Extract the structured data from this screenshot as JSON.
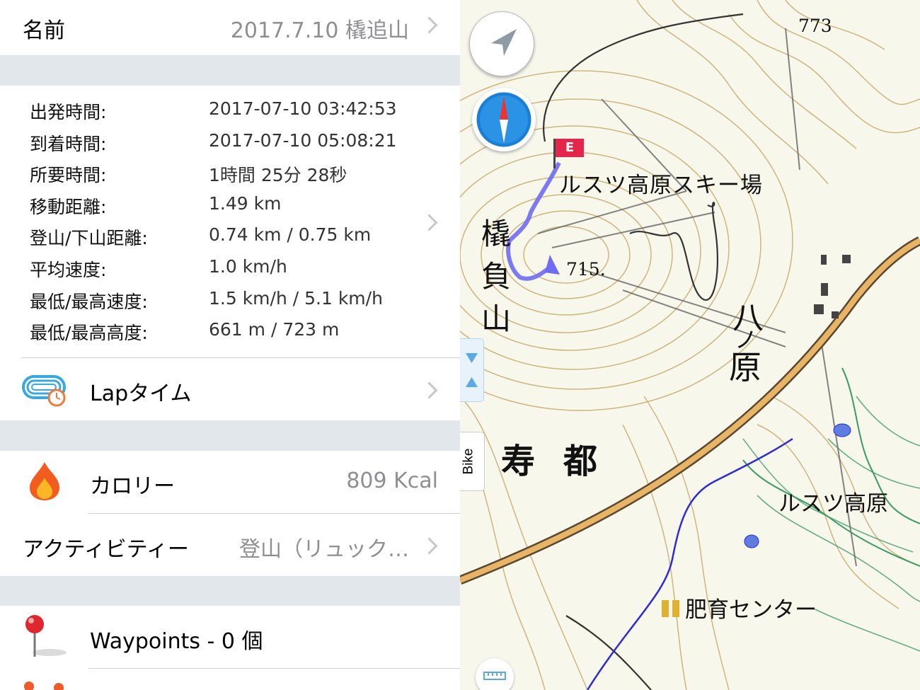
{
  "header": {
    "name_label": "名前",
    "name_value": "2017.7.10 橇追山"
  },
  "stats": [
    {
      "key": "出発時間:",
      "value": "2017-07-10 03:42:53"
    },
    {
      "key": "到着時間:",
      "value": "2017-07-10 05:08:21"
    },
    {
      "key": "所要時間:",
      "value": "1時間 25分 28秒"
    },
    {
      "key": "移動距離:",
      "value": "1.49 km"
    },
    {
      "key": "登山/下山距離:",
      "value": "0.74 km / 0.75 km"
    },
    {
      "key": "平均速度:",
      "value": "1.0 km/h"
    },
    {
      "key": "最低/最高速度:",
      "value": "1.5 km/h / 5.1 km/h"
    },
    {
      "key": "最低/最高高度:",
      "value": "661 m / 723 m"
    }
  ],
  "lap": {
    "label": "Lapタイム"
  },
  "calorie": {
    "label": "カロリー",
    "value": "809 Kcal"
  },
  "activity": {
    "label": "アクティビティー",
    "value": "登山（リュック…"
  },
  "waypoints": {
    "label": "Waypoints - 0 個"
  },
  "map": {
    "elevation_773": "773",
    "elevation_715": "715.",
    "end_flag": "E",
    "bike_tab": "Bike",
    "place_rusutsu_ski": "ルスツ高原スキー場",
    "place_sori_1": "橇",
    "place_sori_2": "負",
    "place_sori_3": "山",
    "place_hachi": "八",
    "place_no": "ノ",
    "place_hara": "原",
    "place_kotobuki": "寿",
    "place_to": "都",
    "place_rusutsu_kogen": "ルスツ高原",
    "place_center": "肥育センター",
    "route_color": "#6f6cf2",
    "accent_red": "#e3264a"
  }
}
